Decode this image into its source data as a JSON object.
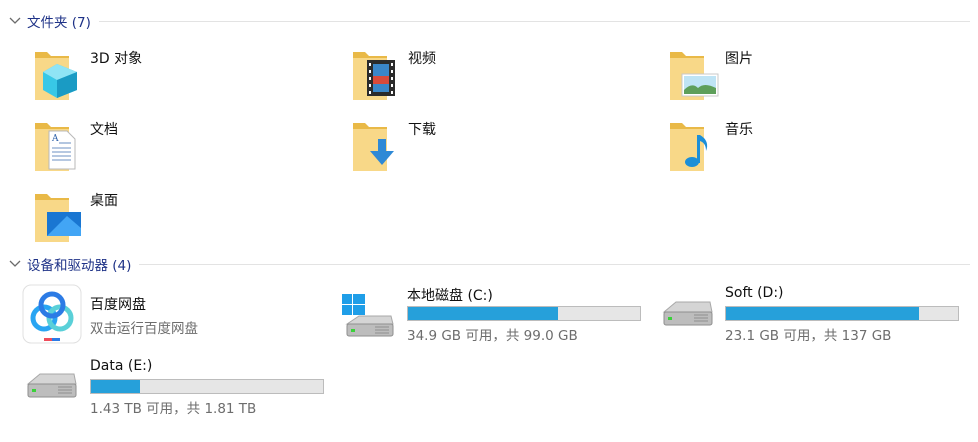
{
  "folders_group": {
    "title": "文件夹 (7)",
    "items": [
      {
        "label": "3D 对象",
        "icon": "3d-objects-folder-icon"
      },
      {
        "label": "视频",
        "icon": "videos-folder-icon"
      },
      {
        "label": "图片",
        "icon": "pictures-folder-icon"
      },
      {
        "label": "文档",
        "icon": "documents-folder-icon"
      },
      {
        "label": "下载",
        "icon": "downloads-folder-icon"
      },
      {
        "label": "音乐",
        "icon": "music-folder-icon"
      },
      {
        "label": "桌面",
        "icon": "desktop-folder-icon"
      }
    ]
  },
  "devices_group": {
    "title": "设备和驱动器 (4)",
    "app": {
      "label": "百度网盘",
      "sublabel": "双击运行百度网盘",
      "icon": "baidu-netdisk-icon"
    },
    "drives": [
      {
        "label": "本地磁盘 (C:)",
        "usage": "34.9 GB 可用，共 99.0 GB",
        "used_fraction": 0.647,
        "icon": "windows-drive-icon"
      },
      {
        "label": "Soft (D:)",
        "usage": "23.1 GB 可用，共 137 GB",
        "used_fraction": 0.831,
        "icon": "hard-drive-icon"
      },
      {
        "label": "Data (E:)",
        "usage": "1.43 TB 可用，共 1.81 TB",
        "used_fraction": 0.21,
        "icon": "hard-drive-icon"
      }
    ]
  },
  "colors": {
    "folder": "#f6d27a",
    "group_title": "#1e3287",
    "bar_fill": "#26a0da",
    "bar_track": "#e6e6e6",
    "sublabel": "#6d6d6d"
  }
}
